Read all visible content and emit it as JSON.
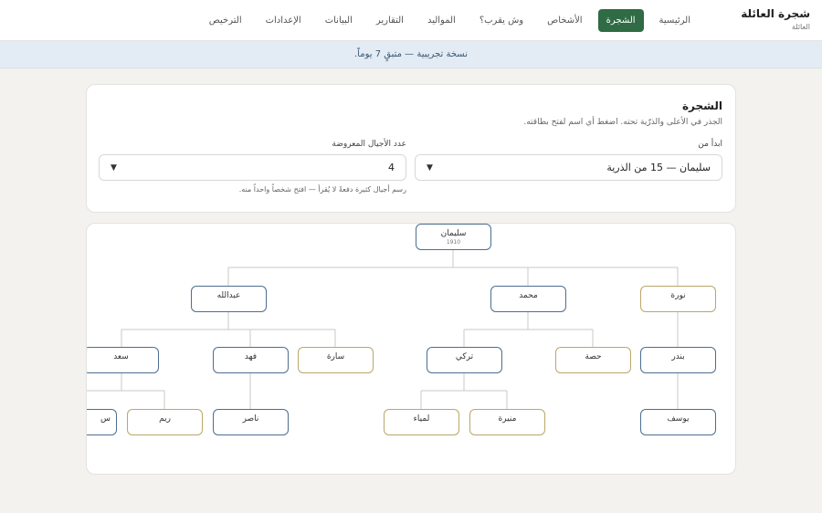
{
  "header": {
    "brand_title": "شجرة العائلة",
    "brand_sub": "العائلة",
    "nav": [
      "الرئيسية",
      "الشجرة",
      "الأشخاص",
      "وش يقرب؟",
      "المواليد",
      "التقارير",
      "البيانات",
      "الإعدادات",
      "الترخيص"
    ],
    "active_nav": "الشجرة"
  },
  "banner": {
    "text": "نسخة تجريبية — متبقٍ 7 يوماً."
  },
  "controls": {
    "title": "الشجرة",
    "subtitle": "الجذر في الأعلى والذرّية تحته. اضغط أي اسم لفتح بطاقته.",
    "start_label": "ابدأ من",
    "start_value": "سليمان — 15 من الذرية",
    "generations_label": "عدد الأجيال المعروضة",
    "generations_value": "4",
    "hint": "رسم أجيال كثيرة دفعةً لا يُقرأ — افتح شخصاً واحداً منه."
  },
  "tree": {
    "root": {
      "name": "سليمان",
      "year": "1910"
    },
    "gen1": [
      {
        "name": "نورة",
        "gender": "female"
      },
      {
        "name": "محمد",
        "gender": "male"
      },
      {
        "name": "عبدالله",
        "gender": "male"
      }
    ],
    "gen2": [
      {
        "name": "بندر",
        "gender": "male"
      },
      {
        "name": "حصة",
        "gender": "female"
      },
      {
        "name": "تركي",
        "gender": "male"
      },
      {
        "name": "سارة",
        "gender": "female"
      },
      {
        "name": "فهد",
        "gender": "male"
      },
      {
        "name": "سعد",
        "gender": "male"
      }
    ],
    "gen3": [
      {
        "name": "يوسف",
        "gender": "male"
      },
      {
        "name": "منيرة",
        "gender": "female"
      },
      {
        "name": "لمياء",
        "gender": "female"
      },
      {
        "name": "ناصر",
        "gender": "male"
      },
      {
        "name": "ريم",
        "gender": "female"
      },
      {
        "name": "س",
        "gender": "male"
      }
    ]
  },
  "colors": {
    "accent": "#2f6b45",
    "male_border": "#4d6e8f",
    "female_border": "#b9a76a",
    "banner_bg": "#e3ecf4"
  }
}
